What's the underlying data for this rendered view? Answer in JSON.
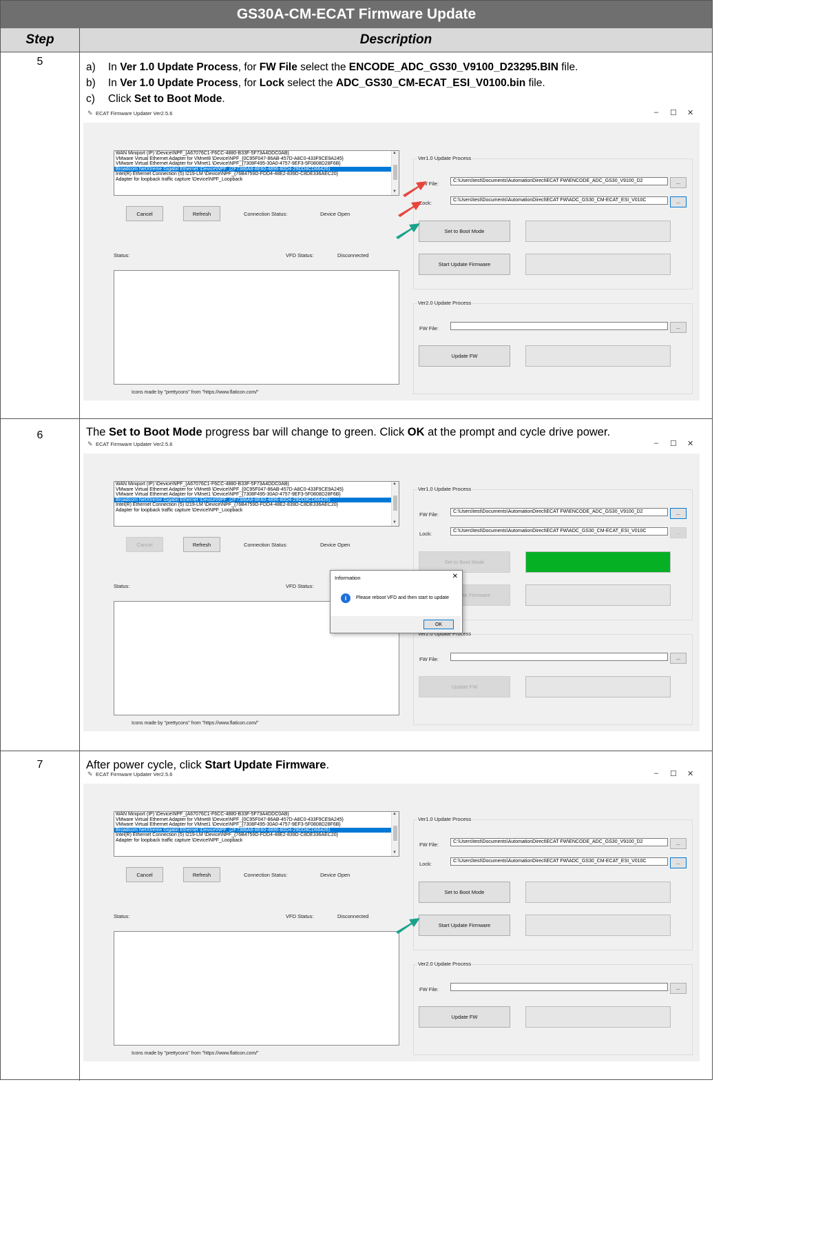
{
  "title": "GS30A-CM-ECAT Firmware Update",
  "headers": {
    "step": "Step",
    "description": "Description"
  },
  "rows": [
    {
      "step": "5",
      "lines": [
        {
          "label": "a)",
          "parts": [
            "In ",
            "Ver 1.0 Update Process",
            ", for ",
            "FW File",
            " select the ",
            "ENCODE_ADC_GS30_V9100_D23295.BIN",
            " file."
          ]
        },
        {
          "label": "b)",
          "parts": [
            "In ",
            "Ver 1.0 Update Process",
            ", for ",
            "Lock",
            " select the ",
            "ADC_GS30_CM-ECAT_ESI_V0100.bin",
            " file."
          ]
        },
        {
          "label": "c)",
          "parts": [
            "Click ",
            "Set to Boot Mode",
            "."
          ]
        }
      ],
      "vfd_status": "Disconnected"
    },
    {
      "step": "6",
      "parts": [
        "The ",
        "Set to Boot Mode",
        " progress bar will change to green. Click ",
        "OK",
        " at the prompt and cycle drive power."
      ],
      "vfd_status": ""
    },
    {
      "step": "7",
      "parts": [
        "After power cycle, click ",
        "Start Update Firmware",
        "."
      ],
      "vfd_status": "Disconnected"
    }
  ],
  "app": {
    "window_title": "ECAT Firmware Updater Ver2.5.6",
    "adapters": [
      "WAN Miniport (IP) \\Device\\NPF_{A67076C1-F6CC-4880-B33F-5F73A4DDC0AB}",
      "VMware Virtual Ethernet Adapter for VMnet8 \\Device\\NPF_{0C95F047-86AB-457D-A8C0-433F9CE9A245}",
      "VMware Virtual Ethernet Adapter for VMnet1 \\Device\\NPF_{7308F495-30A0-4757-9EF3-5F0808D28F6B}",
      "Broadcom NetXtreme Gigabit Ethernet \\Device\\NPF_{2F7386A8-8E60-4896-80D4-29DD8CD66426}",
      "Intel(R) Ethernet Connection (5) I219-LM \\Device\\NPF_{76B4759D-FDD4-48E2-839D-C8DE336AEC20}",
      "Adapter for loopback traffic capture \\Device\\NPF_Loopback"
    ],
    "selected_adapter_index": 3,
    "cancel": "Cancel",
    "refresh": "Refresh",
    "connection_status_label": "Connection Status:",
    "connection_status_value": "Device Open",
    "status_label": "Status:",
    "vfd_status_label": "VFD Status:",
    "ver1_group": "Ver1.0 Update Process",
    "fw_file_label": "FW File:",
    "lock_label": "Lock:",
    "fw_file_path": "C:\\Users\\test\\Documents\\AutomationDirect\\ECAT FW\\ENCODE_ADC_GS30_V9100_D2",
    "lock_path": "C:\\Users\\test\\Documents\\AutomationDirect\\ECAT FW\\ADC_GS30_CM-ECAT_ESI_V010C",
    "browse": "...",
    "set_boot": "Set to Boot Mode",
    "start_update": "Start Update Firmware",
    "ver2_group": "Ver2.0 Update Process",
    "update_fw": "Update FW",
    "credit": "Icons made by \"prettycons\" from \"https://www.flaticon.com/\"",
    "boot_progress_fraction_row6": 1.0
  },
  "dialog": {
    "title": "Information",
    "message": "Please reboot VFD and then start to update",
    "ok": "OK",
    "icon": "info-icon",
    "close": "✕"
  },
  "colors": {
    "progress_green": "#06b025",
    "arrow_red": "#e8453c",
    "arrow_teal": "#1aa38a",
    "selection_blue": "#0078d7"
  }
}
